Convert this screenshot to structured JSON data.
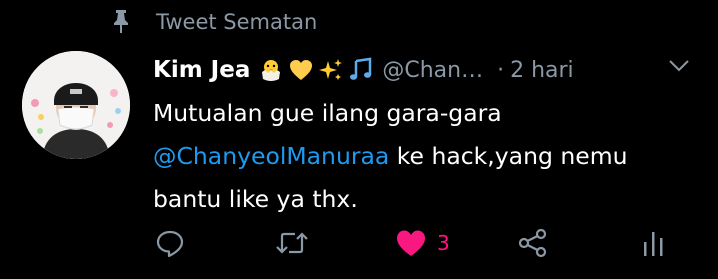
{
  "pinned": {
    "label": "Tweet Sematan",
    "icon": "pin-icon"
  },
  "tweet": {
    "author": {
      "display_name": "Kim Jea",
      "emojis": [
        "hatching-chick-emoji",
        "yellow-heart-emoji",
        "sparkles-emoji",
        "musical-notes-emoji"
      ],
      "handle": "@Chan…",
      "avatar": "avatar"
    },
    "separator": "·",
    "time": "2 hari",
    "text": {
      "line1": "Mutualan gue ilang gara-gara",
      "mention": "@ChanyeolManuraa",
      "rest_line2": " ke hack,yang nemu",
      "line3": "bantu like ya thx."
    },
    "actions": {
      "reply": {
        "icon": "reply-icon"
      },
      "retweet": {
        "icon": "retweet-icon"
      },
      "like": {
        "icon": "heart-icon",
        "count": "3",
        "liked": true
      },
      "share": {
        "icon": "share-icon"
      },
      "analytics": {
        "icon": "analytics-icon"
      }
    }
  },
  "colors": {
    "background": "#000000",
    "text": "#ffffff",
    "secondary": "#8b98a5",
    "link": "#1d9bf0",
    "like": "#f91880"
  }
}
